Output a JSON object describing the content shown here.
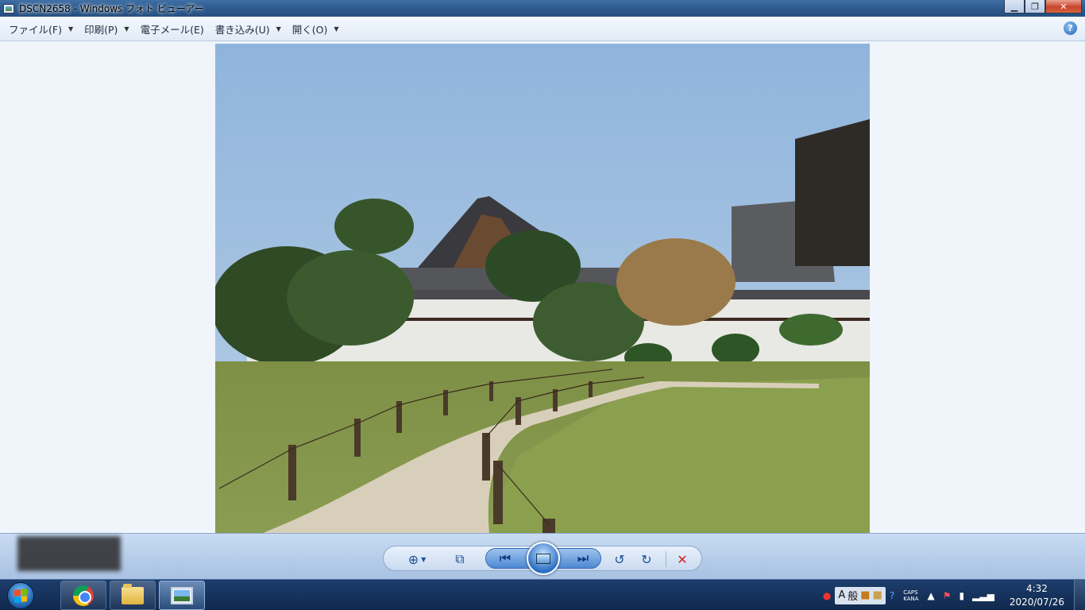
{
  "window": {
    "title": "DSCN2658 - Windows フォト ビューアー"
  },
  "menu": {
    "items": [
      {
        "label": "ファイル(F)",
        "has_dropdown": true
      },
      {
        "label": "印刷(P)",
        "has_dropdown": true
      },
      {
        "label": "電子メール(E)",
        "has_dropdown": false
      },
      {
        "label": "書き込み(U)",
        "has_dropdown": true
      },
      {
        "label": "開く(O)",
        "has_dropdown": true
      }
    ],
    "help_label": "?"
  },
  "controls": {
    "icons": [
      "zoom-icon",
      "fit-window-icon",
      "previous-icon",
      "slideshow-icon",
      "next-icon",
      "rotate-left-icon",
      "rotate-right-icon",
      "delete-icon"
    ]
  },
  "taskbar": {
    "apps": [
      {
        "name": "chrome-icon",
        "active": false
      },
      {
        "name": "explorer-icon",
        "active": false
      },
      {
        "name": "photo-viewer-icon",
        "active": true
      }
    ],
    "tray": {
      "ime_mode": "A",
      "ime_kanji": "般",
      "caps": "CAPS",
      "kana": "KANA",
      "time": "4:32",
      "date": "2020/07/26"
    }
  },
  "colors": {
    "menubar_bg": "#e1ebf7",
    "taskbar_bg": "#10294e",
    "delete_red": "#d42020"
  }
}
